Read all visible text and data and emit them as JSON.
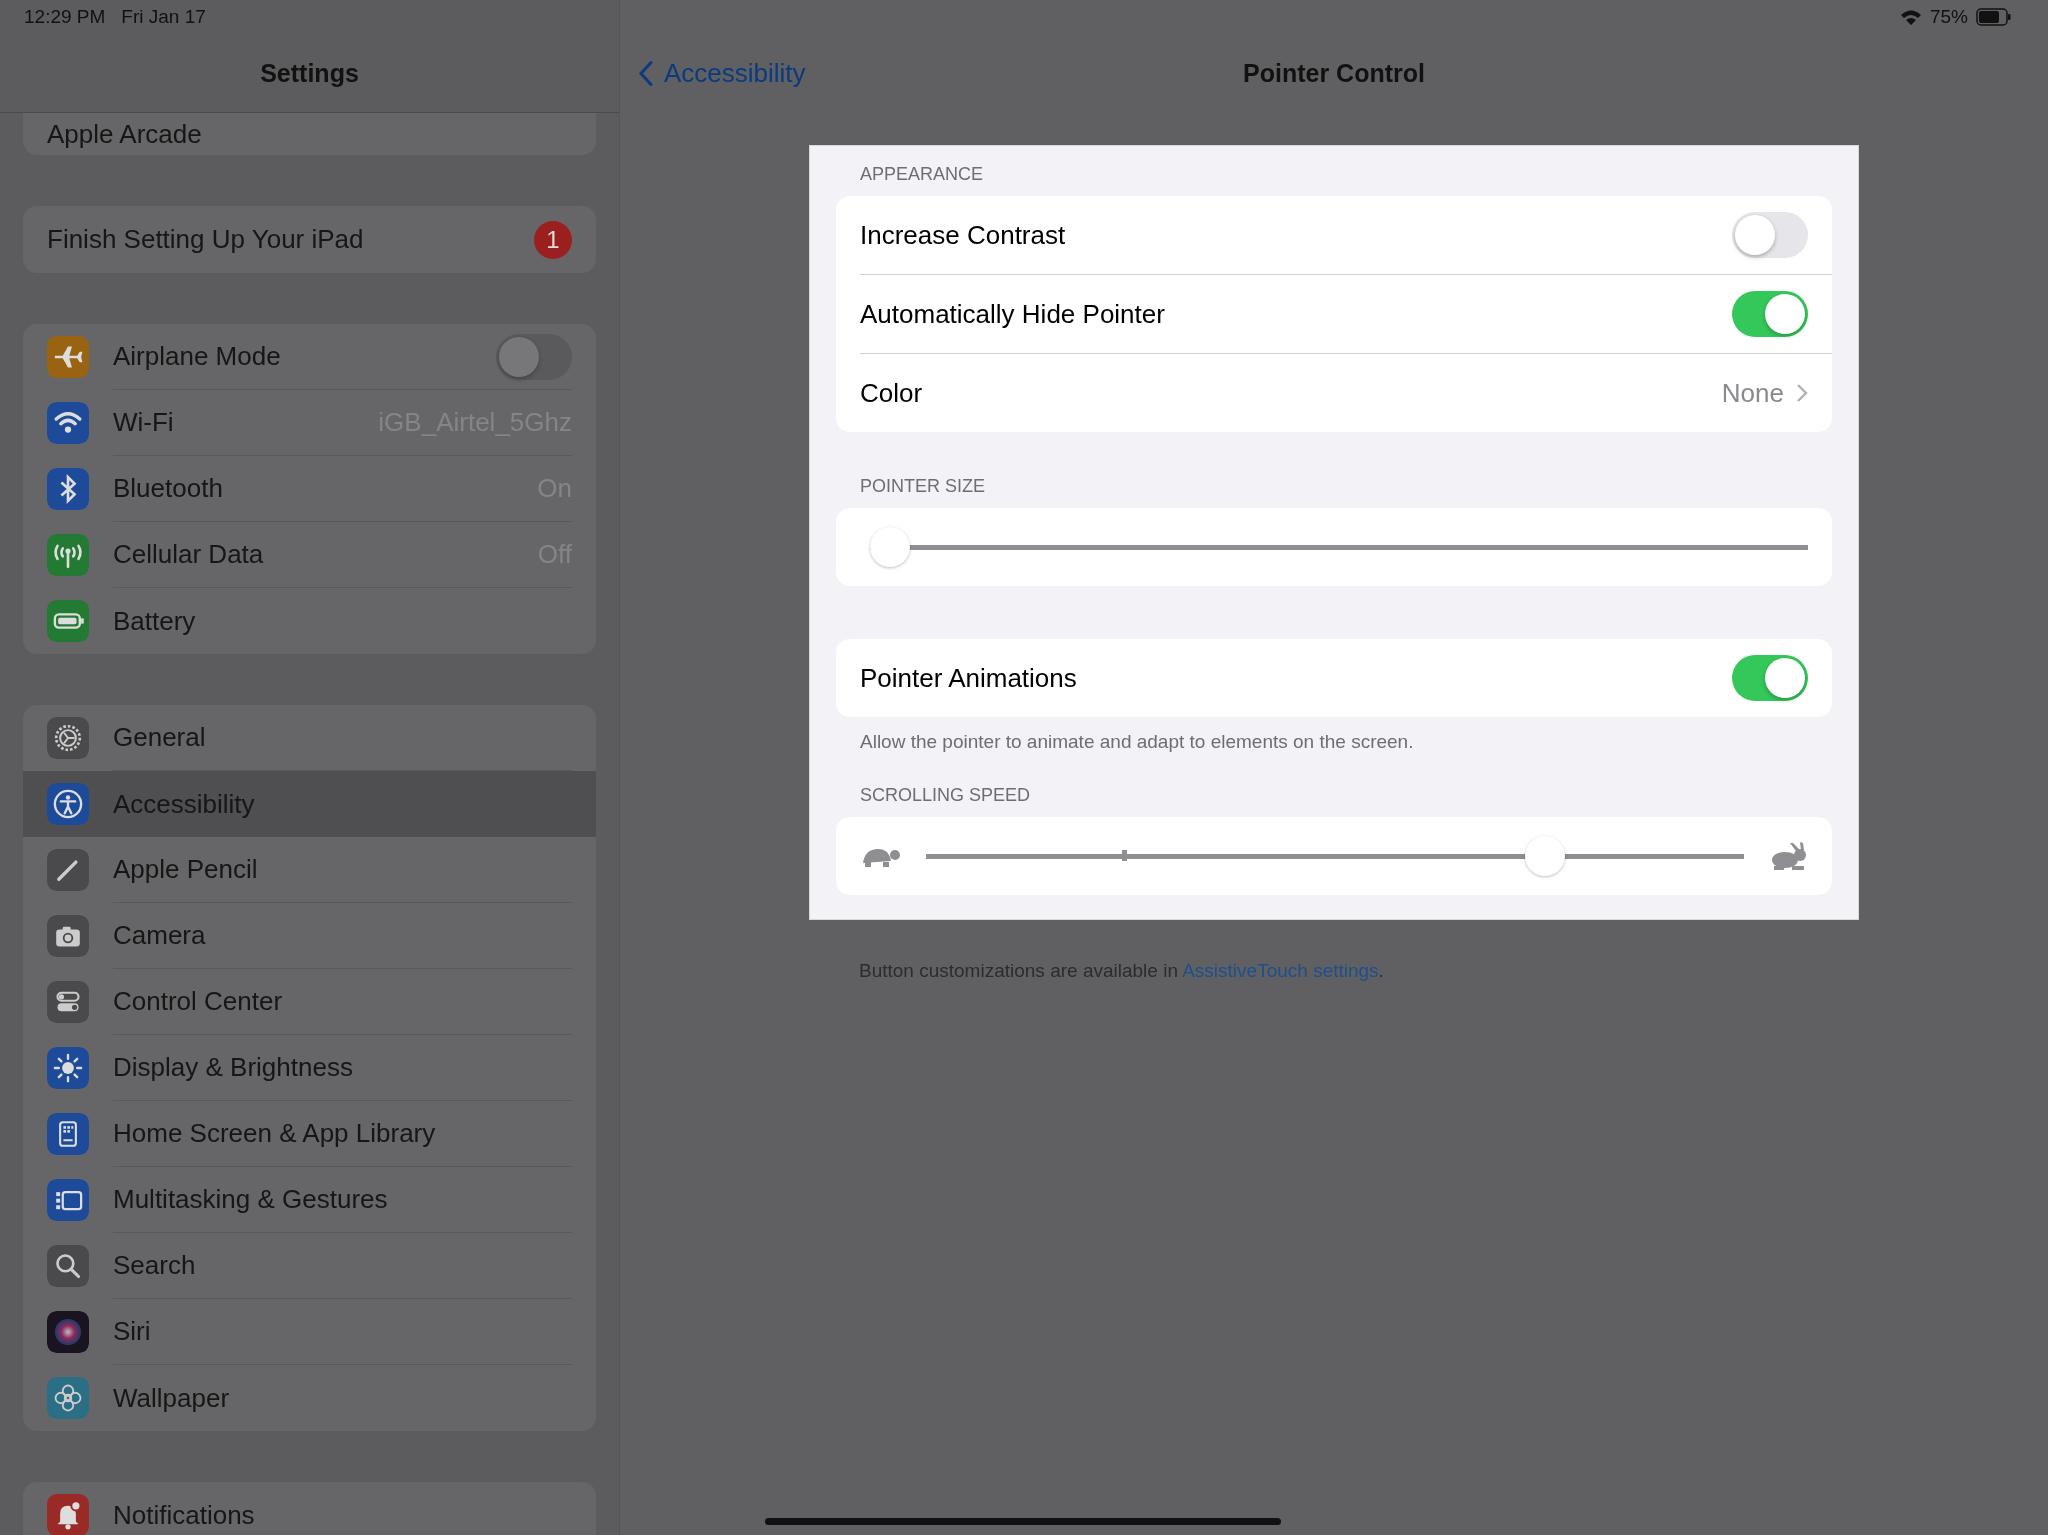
{
  "status_bar": {
    "time": "12:29 PM",
    "date": "Fri Jan 17",
    "battery": "75%"
  },
  "sidebar": {
    "title": "Settings",
    "groups": [
      {
        "items": [
          {
            "label": "Apple Arcade",
            "kind": "plain",
            "selected": false
          }
        ]
      },
      {
        "items": [
          {
            "label": "Finish Setting Up Your iPad",
            "kind": "badge",
            "badge": "1",
            "selected": false
          }
        ]
      },
      {
        "items": [
          {
            "label": "Airplane Mode",
            "kind": "toggle",
            "on": false,
            "selected": false
          },
          {
            "label": "Wi-Fi",
            "kind": "value",
            "value": "iGB_Airtel_5Ghz",
            "selected": false
          },
          {
            "label": "Bluetooth",
            "kind": "value",
            "value": "On",
            "selected": false
          },
          {
            "label": "Cellular Data",
            "kind": "value",
            "value": "Off",
            "selected": false
          },
          {
            "label": "Battery",
            "kind": "plain",
            "selected": false
          }
        ]
      },
      {
        "items": [
          {
            "label": "General",
            "kind": "plain",
            "selected": false
          },
          {
            "label": "Accessibility",
            "kind": "plain",
            "selected": true
          },
          {
            "label": "Apple Pencil",
            "kind": "plain",
            "selected": false
          },
          {
            "label": "Camera",
            "kind": "plain",
            "selected": false
          },
          {
            "label": "Control Center",
            "kind": "plain",
            "selected": false
          },
          {
            "label": "Display & Brightness",
            "kind": "plain",
            "selected": false
          },
          {
            "label": "Home Screen & App Library",
            "kind": "plain",
            "selected": false
          },
          {
            "label": "Multitasking & Gestures",
            "kind": "plain",
            "selected": false
          },
          {
            "label": "Search",
            "kind": "plain",
            "selected": false
          },
          {
            "label": "Siri",
            "kind": "plain",
            "selected": false
          },
          {
            "label": "Wallpaper",
            "kind": "plain",
            "selected": false
          }
        ]
      },
      {
        "items": [
          {
            "label": "Notifications",
            "kind": "plain",
            "selected": false
          }
        ]
      }
    ]
  },
  "detail": {
    "back": "Accessibility",
    "title": "Pointer Control",
    "sections": [
      {
        "header": "APPEARANCE",
        "rows": [
          {
            "kind": "toggle",
            "label": "Increase Contrast",
            "on": false
          },
          {
            "kind": "toggle",
            "label": "Automatically Hide Pointer",
            "on": true
          },
          {
            "kind": "link",
            "label": "Color",
            "value": "None"
          }
        ]
      },
      {
        "header": "POINTER SIZE",
        "rows": [
          {
            "kind": "slider",
            "level": 0
          }
        ]
      },
      {
        "rows": [
          {
            "kind": "toggle",
            "label": "Pointer Animations",
            "on": true
          }
        ],
        "footer": "Allow the pointer to animate and adapt to elements on the screen."
      },
      {
        "header": "SCROLLING SPEED",
        "rows": [
          {
            "kind": "speed",
            "level": 0.77
          }
        ]
      }
    ],
    "note": {
      "text": "Button customizations are available in ",
      "link": "AssistiveTouch settings",
      "after": "."
    }
  }
}
